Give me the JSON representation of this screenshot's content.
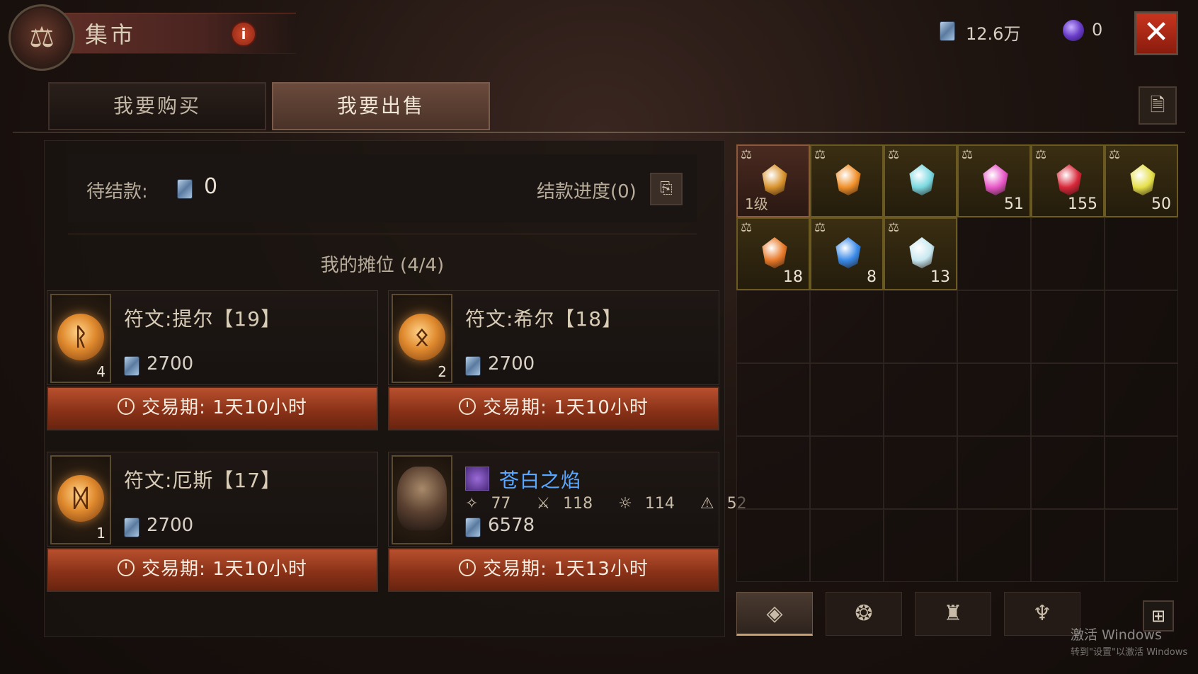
{
  "header": {
    "title": "集市",
    "info_label": "i",
    "emblem_icon": "scales-icon",
    "gold_amount": "12.6万",
    "orb_amount": "0",
    "close_label": "✕"
  },
  "tabs": [
    {
      "label": "我要购买",
      "active": false
    },
    {
      "label": "我要出售",
      "active": true
    }
  ],
  "settlement": {
    "pending_label": "待结款:",
    "pending_value": "0",
    "progress_label": "结款进度(0)"
  },
  "stall": {
    "title": "我的摊位 (4/4)",
    "listings": [
      {
        "name": "符文:提尔【19】",
        "qty": "4",
        "price": "2700",
        "period": "交易期:  1天10小时",
        "icon_glyph": "ᚱ"
      },
      {
        "name": "符文:希尔【18】",
        "qty": "2",
        "price": "2700",
        "period": "交易期:  1天10小时",
        "icon_glyph": "ᛟ"
      },
      {
        "name": "符文:厄斯【17】",
        "qty": "1",
        "price": "2700",
        "period": "交易期:  1天10小时",
        "icon_glyph": "ᛞ"
      },
      {
        "name": "苍白之焰",
        "stats": [
          "77",
          "118",
          "114",
          "52"
        ],
        "price": "6578",
        "period": "交易期:  1天13小时",
        "accent": "#5aa8ff"
      }
    ]
  },
  "inventory": {
    "slots": [
      {
        "gem": "#d9932e",
        "level": "1级",
        "qty": ""
      },
      {
        "gem": "#f0902a",
        "qty": ""
      },
      {
        "gem": "#7ad8e0",
        "qty": ""
      },
      {
        "gem": "#e858c8",
        "qty": "51"
      },
      {
        "gem": "#d8283a",
        "qty": "155"
      },
      {
        "gem": "#e6e04a",
        "qty": "50"
      },
      {
        "gem": "#e87a2a",
        "qty": "18"
      },
      {
        "gem": "#3a8ae8",
        "qty": "8"
      },
      {
        "gem": "#c8e8f0",
        "qty": "13"
      }
    ]
  },
  "categories": [
    {
      "icon": "gem-category-icon",
      "glyph": "◈",
      "active": true
    },
    {
      "icon": "rune-category-icon",
      "glyph": "❂",
      "active": false
    },
    {
      "icon": "bag-category-icon",
      "glyph": "♜",
      "active": false
    },
    {
      "icon": "demon-category-icon",
      "glyph": "♆",
      "active": false
    }
  ],
  "watermark": {
    "line1": "激活 Windows",
    "line2": "转到\"设置\"以激活 Windows"
  }
}
